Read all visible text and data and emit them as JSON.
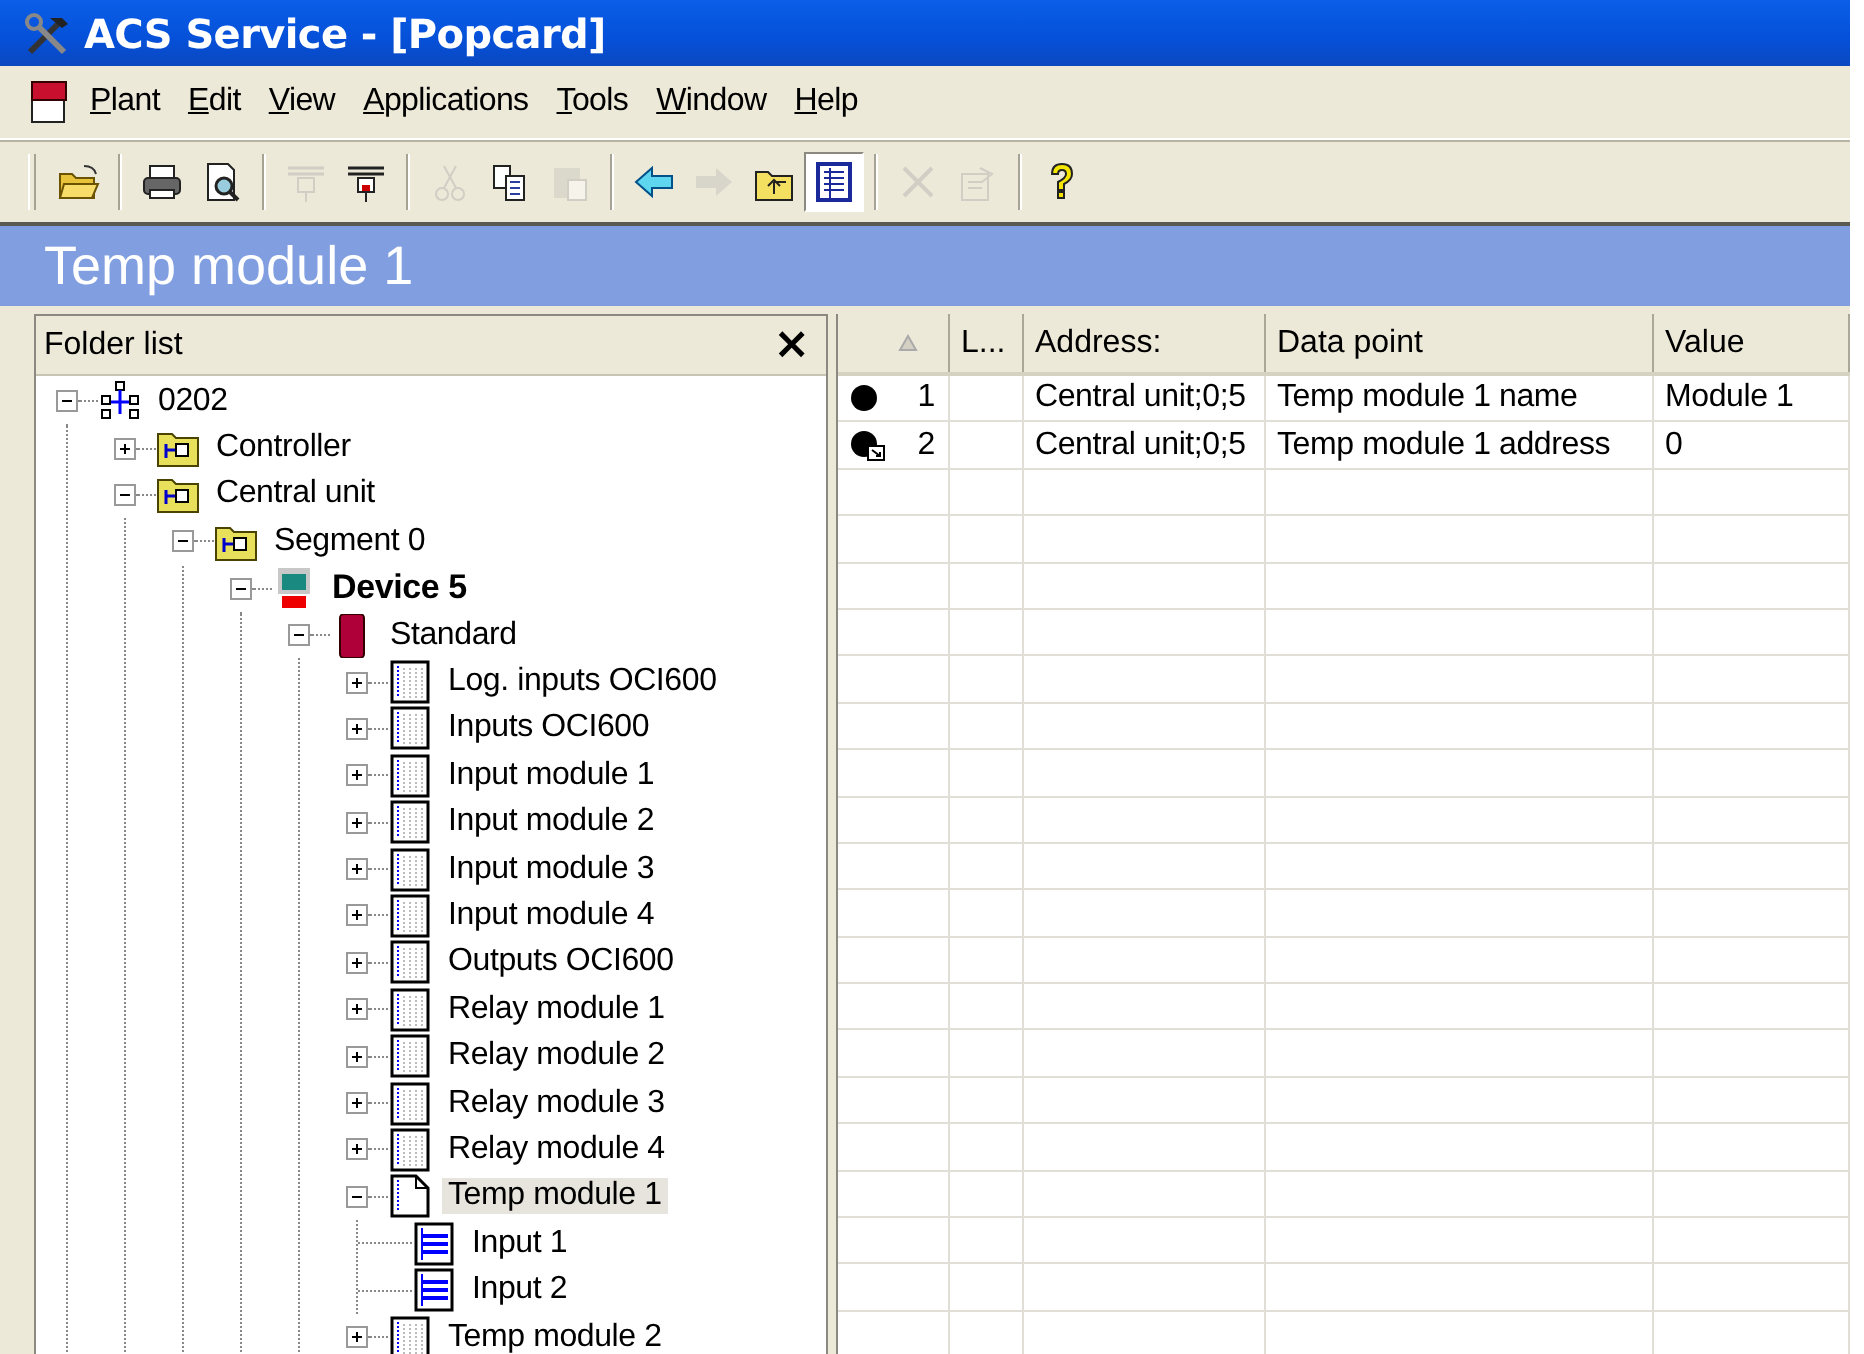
{
  "window": {
    "title": "ACS Service - [Popcard]"
  },
  "menu": [
    "Plant",
    "Edit",
    "View",
    "Applications",
    "Tools",
    "Window",
    "Help"
  ],
  "toolbar": [
    [
      {
        "disabled": false,
        "selected": false
      }
    ],
    [
      {
        "disabled": false,
        "selected": false
      },
      {
        "disabled": false,
        "selected": false
      }
    ],
    [
      {
        "disabled": true,
        "selected": false
      },
      {
        "disabled": false,
        "selected": false
      }
    ],
    [
      {
        "disabled": true,
        "selected": false
      },
      {
        "disabled": false,
        "selected": false
      },
      {
        "disabled": true,
        "selected": false
      }
    ],
    [
      {
        "disabled": false,
        "selected": false
      },
      {
        "disabled": true,
        "selected": false
      },
      {
        "disabled": false,
        "selected": false
      },
      {
        "disabled": false,
        "selected": true
      }
    ],
    [
      {
        "disabled": true,
        "selected": false
      },
      {
        "disabled": true,
        "selected": false
      }
    ],
    [
      {
        "disabled": false,
        "selected": false
      }
    ]
  ],
  "view_title": "Temp module 1",
  "folder_list": {
    "title": "Folder list",
    "close": "×",
    "tree": [
      {
        "label": "0202",
        "kind": "plant",
        "expanded": true,
        "selected": false,
        "children": [
          {
            "label": "Controller",
            "kind": "folder",
            "expanded": false,
            "selected": false
          },
          {
            "label": "Central unit",
            "kind": "folder",
            "expanded": true,
            "selected": false,
            "children": [
              {
                "label": "Segment 0",
                "kind": "folder",
                "expanded": true,
                "selected": false,
                "children": [
                  {
                    "label": "Device 5",
                    "kind": "device",
                    "expanded": true,
                    "selected": false,
                    "children": [
                      {
                        "label": "Standard",
                        "kind": "group",
                        "expanded": true,
                        "selected": false,
                        "children": [
                          {
                            "label": "Log. inputs OCI600",
                            "kind": "module",
                            "expanded": false,
                            "selected": false
                          },
                          {
                            "label": "Inputs OCI600",
                            "kind": "module",
                            "expanded": false,
                            "selected": false
                          },
                          {
                            "label": "Input module 1",
                            "kind": "module",
                            "expanded": false,
                            "selected": false
                          },
                          {
                            "label": "Input module 2",
                            "kind": "module",
                            "expanded": false,
                            "selected": false
                          },
                          {
                            "label": "Input module 3",
                            "kind": "module",
                            "expanded": false,
                            "selected": false
                          },
                          {
                            "label": "Input module 4",
                            "kind": "module",
                            "expanded": false,
                            "selected": false
                          },
                          {
                            "label": "Outputs OCI600",
                            "kind": "module",
                            "expanded": false,
                            "selected": false
                          },
                          {
                            "label": "Relay module 1",
                            "kind": "module",
                            "expanded": false,
                            "selected": false
                          },
                          {
                            "label": "Relay module 2",
                            "kind": "module",
                            "expanded": false,
                            "selected": false
                          },
                          {
                            "label": "Relay module 3",
                            "kind": "module",
                            "expanded": false,
                            "selected": false
                          },
                          {
                            "label": "Relay module 4",
                            "kind": "module",
                            "expanded": false,
                            "selected": false
                          },
                          {
                            "label": "Temp module 1",
                            "kind": "page",
                            "expanded": true,
                            "selected": true,
                            "children": [
                              {
                                "label": "Input 1",
                                "kind": "input",
                                "selected": false
                              },
                              {
                                "label": "Input 2",
                                "kind": "input",
                                "selected": false
                              }
                            ]
                          },
                          {
                            "label": "Temp module 2",
                            "kind": "module",
                            "expanded": false,
                            "selected": false
                          }
                        ]
                      }
                    ]
                  }
                ]
              }
            ]
          }
        ]
      }
    ]
  },
  "table": {
    "columns": [
      "L...",
      "Address:",
      "Data point",
      "Value"
    ],
    "rows": [
      {
        "kind": "plain",
        "number": "1",
        "address": "Central unit;0;5",
        "data_point": "Temp module 1 name",
        "value": "Module 1"
      },
      {
        "kind": "linked",
        "number": "2",
        "address": "Central unit;0;5",
        "data_point": "Temp module 1 address",
        "value": "0"
      }
    ]
  }
}
